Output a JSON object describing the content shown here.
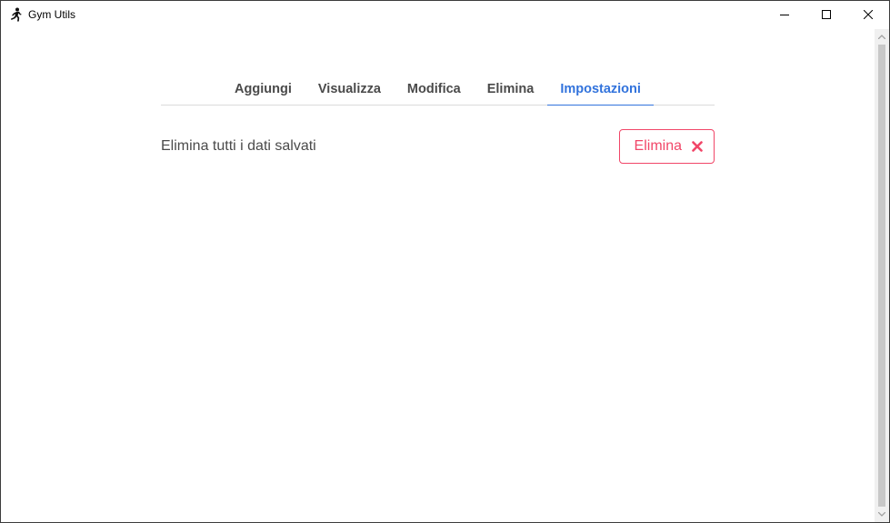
{
  "window": {
    "title": "Gym Utils",
    "icon": "runner-icon",
    "controls": [
      "minimize-icon",
      "maximize-icon",
      "close-icon"
    ]
  },
  "tabs": [
    {
      "label": "Aggiungi",
      "active": false
    },
    {
      "label": "Visualizza",
      "active": false
    },
    {
      "label": "Modifica",
      "active": false
    },
    {
      "label": "Elimina",
      "active": false
    },
    {
      "label": "Impostazioni",
      "active": true
    }
  ],
  "settings": {
    "delete_all": {
      "label": "Elimina tutti i dati salvati",
      "button_label": "Elimina",
      "button_icon": "times-icon"
    }
  },
  "colors": {
    "accent": "#3273dc",
    "danger": "#f14668",
    "text": "#4a4a4a"
  }
}
